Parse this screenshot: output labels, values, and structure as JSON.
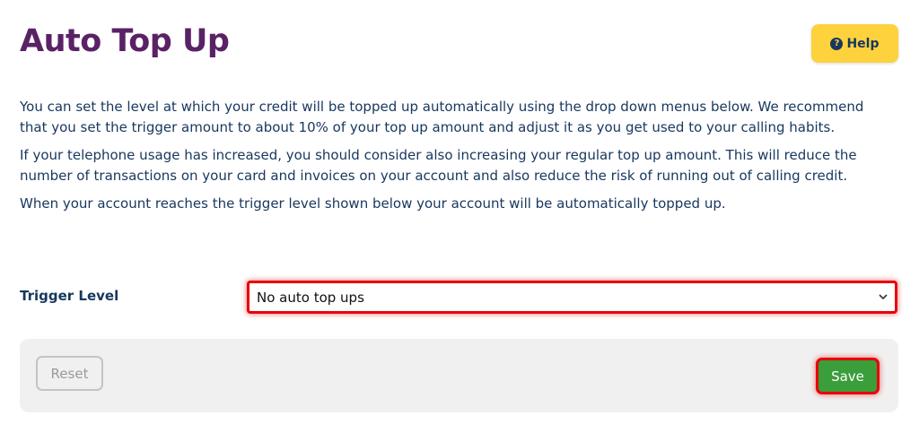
{
  "header": {
    "title": "Auto Top Up",
    "help_label": "Help",
    "help_icon": "question-circle-icon"
  },
  "intro": {
    "paragraphs": [
      "You can set the level at which your credit will be topped up automatically using the drop down menus below. We recommend that you set the trigger amount to about 10% of your top up amount and adjust it as you get used to your calling habits.",
      "If your telephone usage has increased, you should consider also increasing your regular top up amount. This will reduce the number of transactions on your card and invoices on your account and also reduce the risk of running out of calling credit.",
      "When your account reaches the trigger level shown below your account will be automatically topped up."
    ]
  },
  "form": {
    "trigger_label": "Trigger Level",
    "trigger_selected": "No auto top ups"
  },
  "actions": {
    "reset_label": "Reset",
    "save_label": "Save"
  },
  "colors": {
    "title": "#5a2266",
    "text": "#17375e",
    "help_button": "#fdd23c",
    "save_button": "#3a9e3a",
    "highlight": "#e8000a",
    "action_bar": "#f0f0f0"
  }
}
